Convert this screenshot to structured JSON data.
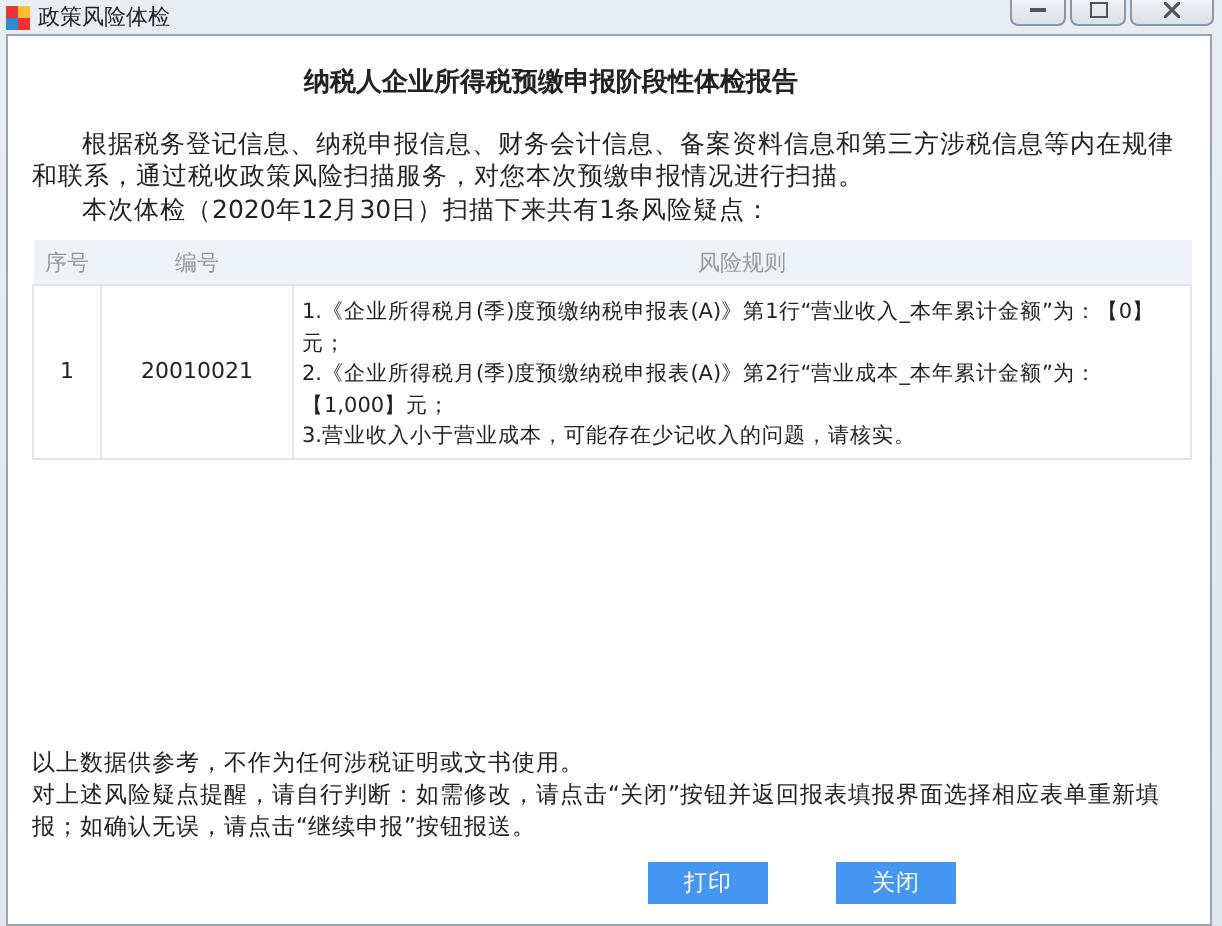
{
  "window": {
    "title": "政策风险体检"
  },
  "report": {
    "title": "纳税人企业所得税预缴申报阶段性体检报告",
    "intro": "根据税务登记信息、纳税申报信息、财务会计信息、备案资料信息和第三方涉税信息等内在规律和联系，通过税收政策风险扫描服务，对您本次预缴申报情况进行扫描。",
    "summary": "本次体检（2020年12月30日）扫描下来共有1条风险疑点："
  },
  "table": {
    "columns": [
      "序号",
      "编号",
      "风险规则"
    ],
    "rows": [
      {
        "index": "1",
        "code": "20010021",
        "rules": [
          "1.《企业所得税月(季)度预缴纳税申报表(A)》第1行“营业收入_本年累计金额”为：【0】元；",
          "2.《企业所得税月(季)度预缴纳税申报表(A)》第2行“营业成本_本年累计金额”为：【1,000】元；",
          "3.营业收入小于营业成本，可能存在少记收入的问题，请核实。"
        ]
      }
    ]
  },
  "notes": [
    "以上数据供参考，不作为任何涉税证明或文书使用。",
    "对上述风险疑点提醒，请自行判断：如需修改，请点击“关闭”按钮并返回报表填报界面选择相应表单重新填报；如确认无误，请点击“继续申报”按钮报送。"
  ],
  "buttons": [
    "打印",
    "关闭"
  ]
}
